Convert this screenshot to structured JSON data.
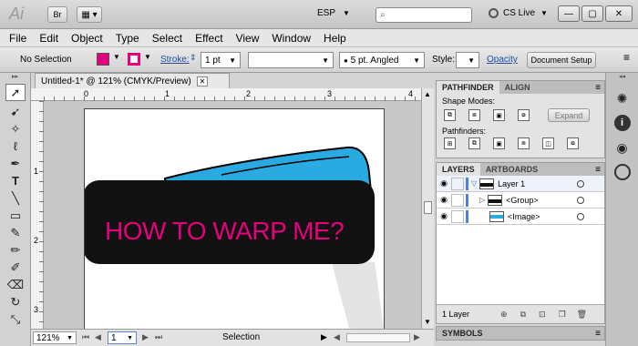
{
  "app": {
    "logo": "Ai",
    "bridge_label": "Br",
    "language": "ESP",
    "cs_live": "CS Live",
    "colors": {
      "fill": "#e6007e",
      "stroke": "#e6007e",
      "shape_dark": "#111111",
      "shape_blue": "#29abe2",
      "text_pink": "#e6007e"
    }
  },
  "menu": [
    "File",
    "Edit",
    "Object",
    "Type",
    "Select",
    "Effect",
    "View",
    "Window",
    "Help"
  ],
  "control": {
    "selection": "No Selection",
    "stroke_label": "Stroke:",
    "stroke_weight": "1 pt",
    "brush": "5 pt. Angled",
    "style_label": "Style:",
    "opacity_label": "Opacity",
    "doc_setup": "Document Setup"
  },
  "document": {
    "tab_title": "Untitled-1* @ 121% (CMYK/Preview)",
    "ruler_h": [
      "0",
      "1",
      "2",
      "3",
      "4"
    ],
    "ruler_v": [
      "1",
      "2",
      "3"
    ],
    "artwork_text": "HOW TO WARP ME?",
    "zoom": "121%",
    "page": "1",
    "status": "Selection"
  },
  "pathfinder": {
    "tab_active": "PATHFINDER",
    "tab_other": "ALIGN",
    "shape_modes_label": "Shape Modes:",
    "expand_label": "Expand",
    "pathfinders_label": "Pathfinders:"
  },
  "layers": {
    "tab_active": "LAYERS",
    "tab_other": "ARTBOARDS",
    "rows": [
      {
        "name": "Layer 1"
      },
      {
        "name": "<Group>"
      },
      {
        "name": "<Image>"
      }
    ],
    "count": "1 Layer"
  },
  "symbols": {
    "tab": "SYMBOLS"
  }
}
